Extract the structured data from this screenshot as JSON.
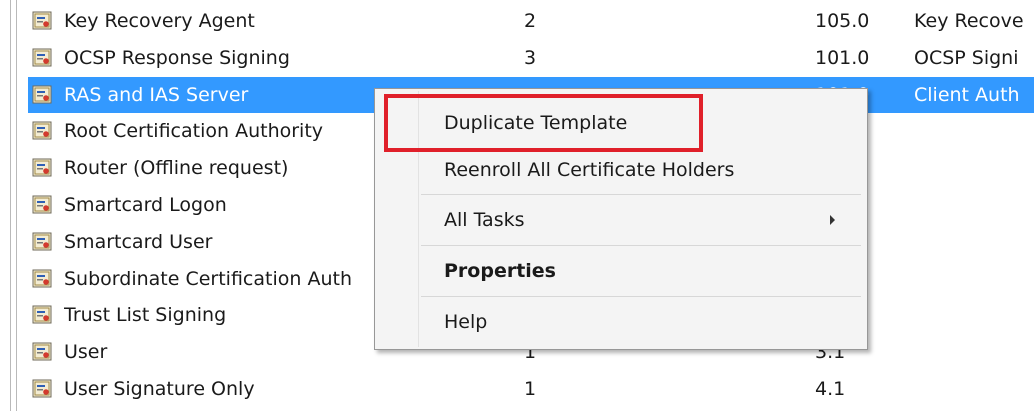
{
  "rows": [
    {
      "name": "Key Recovery Agent",
      "version": "2",
      "minor": "105.0",
      "purpose": "Key Recove"
    },
    {
      "name": "OCSP Response Signing",
      "version": "3",
      "minor": "101.0",
      "purpose": "OCSP Signi"
    },
    {
      "name": "RAS and IAS Server",
      "version": "",
      "minor": "101.0",
      "purpose": "Client Auth"
    },
    {
      "name": "Root Certification Authority",
      "version": "",
      "minor": "",
      "purpose": ""
    },
    {
      "name": "Router (Offline request)",
      "version": "",
      "minor": "",
      "purpose": ""
    },
    {
      "name": "Smartcard Logon",
      "version": "",
      "minor": "",
      "purpose": ""
    },
    {
      "name": "Smartcard User",
      "version": "",
      "minor": "",
      "purpose": ""
    },
    {
      "name": "Subordinate Certification Auth",
      "version": "",
      "minor": "",
      "purpose": ""
    },
    {
      "name": "Trust List Signing",
      "version": "",
      "minor": "",
      "purpose": ""
    },
    {
      "name": "User",
      "version": "1",
      "minor": "3.1",
      "purpose": ""
    },
    {
      "name": "User Signature Only",
      "version": "1",
      "minor": "4.1",
      "purpose": ""
    }
  ],
  "selected_row": "RAS and IAS Server",
  "context_menu": {
    "duplicate_template": "Duplicate Template",
    "reenroll_all": "Reenroll All Certificate Holders",
    "all_tasks": "All Tasks",
    "properties": "Properties",
    "help": "Help"
  },
  "colors": {
    "selection": "#3399ff",
    "highlight_box": "#e0202a",
    "menu_background": "#f4f4f4"
  },
  "icons": {
    "row_icon": "certificate-template-icon",
    "submenu_arrow": "submenu-arrow-icon"
  }
}
